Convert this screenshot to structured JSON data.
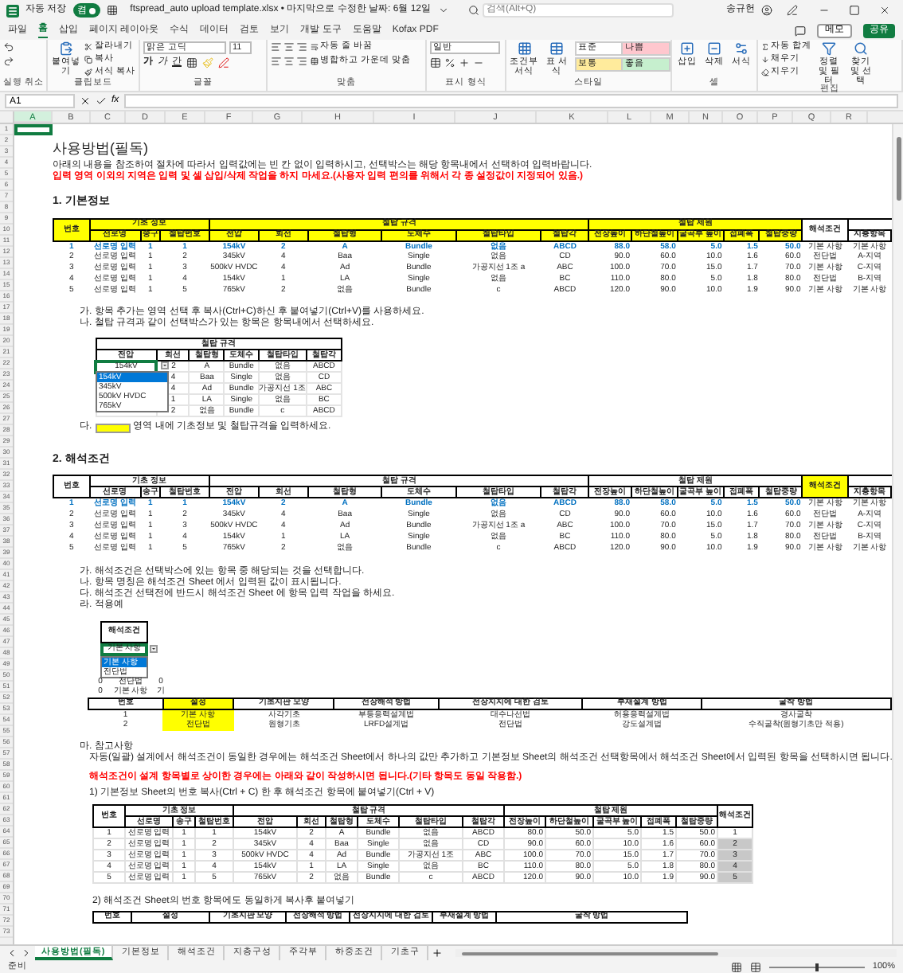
{
  "title_bar": {
    "autosave": "자동 저장",
    "autosave_on": true,
    "toggle_label": "켬",
    "filename": "ftspread_auto upload template.xlsx • 마지막으로 수정한 날짜: 6월 12일",
    "search_placeholder": "검색(Alt+Q)",
    "user": "송규헌"
  },
  "menu": [
    {
      "label": "파일",
      "selected": false
    },
    {
      "label": "홈",
      "selected": true
    },
    {
      "label": "삽입",
      "selected": false
    },
    {
      "label": "페이지 레이아웃",
      "selected": false
    },
    {
      "label": "수식",
      "selected": false
    },
    {
      "label": "데이터",
      "selected": false
    },
    {
      "label": "검토",
      "selected": false
    },
    {
      "label": "보기",
      "selected": false
    },
    {
      "label": "개발 도구",
      "selected": false
    },
    {
      "label": "도움말",
      "selected": false
    },
    {
      "label": "Kofax PDF",
      "selected": false
    }
  ],
  "menu_right": {
    "comment": "메모",
    "share": "공유"
  },
  "ribbon": {
    "undo": {
      "label": "실행 취소"
    },
    "clipboard": {
      "label": "클립보드",
      "paste": "붙여넣기",
      "cut": "잘라내기",
      "copy": "복사",
      "format_painter": "서식 복사"
    },
    "font": {
      "label": "글꼴",
      "font": "맑은 고딕",
      "size": "11",
      "bold": "가",
      "italic": "가",
      "underline": "간"
    },
    "align": {
      "label": "맞춤",
      "wrap": "자동 줄 바꿈",
      "merge": "병합하고 가운데 맞춤"
    },
    "number": {
      "label": "표시 형식",
      "format": "일반"
    },
    "styles": {
      "label": "스타일",
      "conditional": "조건부 서식",
      "table": "표 서식",
      "cells": [
        {
          "label": "표준",
          "color": "#ffffff"
        },
        {
          "label": "나쁨",
          "color": "#ffc7ce"
        },
        {
          "label": "보통",
          "color": "#ffeb9c"
        },
        {
          "label": "좋음",
          "color": "#c6efce"
        }
      ]
    },
    "cells": {
      "label": "셀",
      "insert": "삽입",
      "delete": "삭제",
      "format": "서식"
    },
    "edit": {
      "label": "편집",
      "autosum": "자동 합계",
      "fill": "채우기",
      "clear": "지우기",
      "sort": "정렬 및 필터",
      "find": "찾기 및 선택"
    }
  },
  "formula_bar": {
    "name_box": "A1",
    "function_label": "fx"
  },
  "columns": [
    "A",
    "B",
    "C",
    "D",
    "E",
    "F",
    "G",
    "H",
    "I",
    "J",
    "K",
    "L",
    "M",
    "N",
    "O",
    "P",
    "Q",
    "R"
  ],
  "row_numbers": [
    "1",
    "2",
    "3",
    "4",
    "5",
    "6",
    "7",
    "8",
    "9",
    "10",
    "11",
    "12",
    "13",
    "14",
    "15",
    "16",
    "17",
    "18",
    "19",
    "20",
    "21",
    "22",
    "23",
    "24",
    "25",
    "26",
    "27",
    "28",
    "29",
    "30",
    "31",
    "32",
    "33",
    "34",
    "35",
    "36",
    "37",
    "38",
    "39",
    "40",
    "41",
    "42",
    "43",
    "44",
    "45",
    "46",
    "47",
    "48",
    "49",
    "50",
    "51",
    "52",
    "53",
    "54",
    "55",
    "56",
    "57",
    "58",
    "59",
    "60",
    "61",
    "62",
    "63",
    "64",
    "65",
    "66",
    "67",
    "68",
    "69",
    "70",
    "71",
    "72",
    "73"
  ],
  "sheet": {
    "title": "사용방법(필독)",
    "intro": "아래의 내용을 참조하여 절차에 따라서 입력값에는 빈 칸 없이 입력하시고, 선택박스는 해당 항목내에서 선택하여 입력바랍니다.",
    "warning": "입력 영역 이외의 지역은 입력 및 셀 삽입/삭제 작업을 하지 마세요.(사용자 입력 편의를 위해서 각 종 설정값이 지정되어 있음.)",
    "section1": {
      "heading": "1. 기본정보",
      "table": {
        "groups": [
          {
            "label": "번호",
            "highlighted": true
          },
          {
            "label": "기초 정보",
            "highlighted": true,
            "columns": [
              "선로명",
              "송구",
              "철탑번호"
            ]
          },
          {
            "label": "철탑 규격",
            "highlighted": true,
            "columns": [
              "전압",
              "회선",
              "철탑형",
              "도체수",
              "철탑타입",
              "철탑각"
            ]
          },
          {
            "label": "철탑 제원",
            "highlighted": true,
            "columns": [
              "전장높이",
              "하단철높이",
              "굴곡부 높이",
              "접폐폭",
              "철탑중량"
            ]
          },
          {
            "label": "해석조건",
            "highlighted": false
          },
          {
            "highlighted": false,
            "columns": [
              "지층항목"
            ]
          }
        ],
        "rows": [
          {
            "highlighted": true,
            "cells": [
              "1",
              "선로명 입력",
              "1",
              "1",
              "154kV",
              "2",
              "A",
              "Bundle",
              "없음",
              "ABCD",
              "88.0",
              "58.0",
              "5.0",
              "1.5",
              "50.0",
              "기본 사항",
              "기본 사항"
            ]
          },
          {
            "highlighted": false,
            "cells": [
              "2",
              "선로명 입력",
              "1",
              "2",
              "345kV",
              "4",
              "Baa",
              "Single",
              "없음",
              "CD",
              "90.0",
              "60.0",
              "10.0",
              "1.6",
              "60.0",
              "전단법",
              "A-지역"
            ]
          },
          {
            "highlighted": false,
            "cells": [
              "3",
              "선로명 입력",
              "1",
              "3",
              "500kV HVDC",
              "4",
              "Ad",
              "Bundle",
              "가공지선 1조 a",
              "ABC",
              "100.0",
              "70.0",
              "15.0",
              "1.7",
              "70.0",
              "기본 사항",
              "C-지역"
            ]
          },
          {
            "highlighted": false,
            "cells": [
              "4",
              "선로명 입력",
              "1",
              "4",
              "154kV",
              "1",
              "LA",
              "Single",
              "없음",
              "BC",
              "110.0",
              "80.0",
              "5.0",
              "1.8",
              "80.0",
              "전단법",
              "B-지역"
            ]
          },
          {
            "highlighted": false,
            "cells": [
              "5",
              "선로명 입력",
              "1",
              "5",
              "765kV",
              "2",
              "없음",
              "Bundle",
              "c",
              "ABCD",
              "120.0",
              "90.0",
              "10.0",
              "1.9",
              "90.0",
              "기본 사항",
              "기본 사항"
            ]
          }
        ]
      },
      "notes": [
        "가. 항목 추가는 영역 선택 후 복사(Ctrl+C)하신 후 붙여넣기(Ctrl+V)를 사용하세요.",
        "나. 철탑 규격과 같이 선택박스가 있는 항목은 항목내에서 선택하세요."
      ],
      "spec_example": {
        "header": "철탑 규격",
        "columns": [
          "전압",
          "회선",
          "철탑형",
          "도체수",
          "철탑타입",
          "철탑각"
        ],
        "first_row": [
          "154kV",
          "2",
          "A",
          "Bundle",
          "없음",
          "ABCD"
        ],
        "options": [
          {
            "label": "154kV",
            "selected": true
          },
          {
            "label": "345kV",
            "selected": false
          },
          {
            "label": "500kV HVDC",
            "selected": false
          },
          {
            "label": "765kV",
            "selected": false
          }
        ],
        "rows": [
          [
            "",
            "4",
            "Baa",
            "Single",
            "없음",
            "CD"
          ],
          [
            "",
            "4",
            "Ad",
            "Bundle",
            "가공지선 1조",
            "ABC"
          ],
          [
            "",
            "1",
            "LA",
            "Single",
            "없음",
            "BC"
          ],
          [
            "",
            "2",
            "없음",
            "Bundle",
            "c",
            "ABCD"
          ]
        ]
      },
      "note_c": {
        "prefix": "다.",
        "text": "영역 내에 기초정보 및 철탑규격을 입력하세요."
      }
    },
    "section2": {
      "heading": "2. 해석조건",
      "table": {
        "groups": [
          {
            "label": "번호",
            "highlighted": false
          },
          {
            "label": "기초 정보",
            "highlighted": false,
            "columns": [
              "선로명",
              "송구",
              "철탑번호"
            ]
          },
          {
            "label": "철탑 규격",
            "highlighted": false,
            "columns": [
              "전압",
              "회선",
              "철탑형",
              "도체수",
              "철탑타입",
              "철탑각"
            ]
          },
          {
            "label": "철탑 제원",
            "highlighted": false,
            "columns": [
              "전장높이",
              "하단철높이",
              "굴곡부 높이",
              "접폐폭",
              "철탑중량"
            ]
          },
          {
            "label": "해석조건",
            "highlighted": true
          },
          {
            "highlighted": false,
            "columns": [
              "지층항목"
            ]
          }
        ],
        "rows": [
          {
            "highlighted": true,
            "cells": [
              "1",
              "선로명 입력",
              "1",
              "1",
              "154kV",
              "2",
              "A",
              "Bundle",
              "없음",
              "ABCD",
              "88.0",
              "58.0",
              "5.0",
              "1.5",
              "50.0",
              "기본 사항",
              "기본 사항"
            ]
          },
          {
            "highlighted": false,
            "cells": [
              "2",
              "선로명 입력",
              "1",
              "2",
              "345kV",
              "4",
              "Baa",
              "Single",
              "없음",
              "CD",
              "90.0",
              "60.0",
              "10.0",
              "1.6",
              "60.0",
              "전단법",
              "A-지역"
            ]
          },
          {
            "highlighted": false,
            "cells": [
              "3",
              "선로명 입력",
              "1",
              "3",
              "500kV HVDC",
              "4",
              "Ad",
              "Bundle",
              "가공지선 1조 a",
              "ABC",
              "100.0",
              "70.0",
              "15.0",
              "1.7",
              "70.0",
              "기본 사항",
              "C-지역"
            ]
          },
          {
            "highlighted": false,
            "cells": [
              "4",
              "선로명 입력",
              "1",
              "4",
              "154kV",
              "1",
              "LA",
              "Single",
              "없음",
              "BC",
              "110.0",
              "80.0",
              "5.0",
              "1.8",
              "80.0",
              "전단법",
              "B-지역"
            ]
          },
          {
            "highlighted": false,
            "cells": [
              "5",
              "선로명 입력",
              "1",
              "5",
              "765kV",
              "2",
              "없음",
              "Bundle",
              "c",
              "ABCD",
              "120.0",
              "90.0",
              "10.0",
              "1.9",
              "90.0",
              "기본 사항",
              "기본 사항"
            ]
          }
        ]
      },
      "notes": [
        "가. 해석조건은 선택박스에 있는 항목 중 해당되는 것을 선택합니다.",
        "나. 항목 명칭은 해석조건 Sheet 에서 입력된 값이 표시됩니다.",
        "다. 해석조건 선택전에 반드시 해석조건 Sheet 에 항목 입력 작업을 하세요.",
        "라. 적용예"
      ],
      "condition_example": {
        "header": "해석조건",
        "value": "기본 사항",
        "options": [
          {
            "label": "기본 사항",
            "selected": true
          },
          {
            "label": "전단법",
            "selected": false
          }
        ],
        "rows": [
          [
            "0",
            "전단법",
            "0"
          ],
          [
            "0",
            "기본 사항",
            "기"
          ]
        ]
      },
      "condition_table": {
        "columns": [
          {
            "label": "번호",
            "highlighted": false
          },
          {
            "label": "설정",
            "highlighted": true
          },
          {
            "label": "기초지판 모양",
            "highlighted": false
          },
          {
            "label": "전장해석 방법",
            "highlighted": false
          },
          {
            "label": "전장지지에 대한 검토",
            "highlighted": false
          },
          {
            "label": "부재설계 방법",
            "highlighted": false
          },
          {
            "label": "굴착 방법",
            "highlighted": false
          }
        ],
        "rows": [
          [
            "1",
            "기본 사항",
            "사각기초",
            "부등응력설계법",
            "대수나선법",
            "허용응력설계법",
            "경사굴착"
          ],
          [
            "2",
            "전단법",
            "원형기초",
            "LRFD설계법",
            "전단법",
            "강도설계법",
            "수직굴착(원형기초만 적용)"
          ]
        ]
      },
      "reference": {
        "heading": "마. 참고사항",
        "text": "자동(일괄) 설계에서 해석조건이 동일한 경우에는 해석조건 Sheet에서 하나의 값만 추가하고 기본정보 Sheet의 해석조건 선택항목에서 해석조건 Sheet에서 입력된 항목을 선택하시면 됩니다.",
        "warning": "해석조건이 설계 항목별로 상이한 경우에는 아래와 같이 작성하시면 됩니다.(기타 항목도 동일 작용함.)",
        "step1": "1) 기본정보 Sheet의 번호 복사(Ctrl + C) 한 후 해석조건 항목에 붙여넣기(Ctrl + V)",
        "table": {
          "groups": [
            {
              "label": "번호",
              "highlighted": false
            },
            {
              "label": "기초 정보",
              "highlighted": false,
              "columns": [
                "선로명",
                "송구",
                "철탑번호"
              ]
            },
            {
              "label": "철탑 규격",
              "highlighted": false,
              "columns": [
                "전압",
                "회선",
                "철탑형",
                "도체수",
                "철탑타입",
                "철탑각"
              ]
            },
            {
              "label": "철탑 제원",
              "highlighted": false,
              "columns": [
                "전장높이",
                "하단철높이",
                "굴곡부 높이",
                "접폐폭",
                "철탑중량"
              ]
            },
            {
              "label": "해석조건",
              "highlighted": false
            }
          ],
          "rows": [
            {
              "shaded": false,
              "cells": [
                "1",
                "선로명 입력",
                "1",
                "1",
                "154kV",
                "2",
                "A",
                "Bundle",
                "없음",
                "ABCD",
                "80.0",
                "50.0",
                "5.0",
                "1.5",
                "50.0",
                "1"
              ]
            },
            {
              "shaded": true,
              "cells": [
                "2",
                "선로명 입력",
                "1",
                "2",
                "345kV",
                "4",
                "Baa",
                "Single",
                "없음",
                "CD",
                "90.0",
                "60.0",
                "10.0",
                "1.6",
                "60.0",
                "2"
              ]
            },
            {
              "shaded": true,
              "cells": [
                "3",
                "선로명 입력",
                "1",
                "3",
                "500kV HVDC",
                "4",
                "Ad",
                "Bundle",
                "가공지선 1조",
                "ABC",
                "100.0",
                "70.0",
                "15.0",
                "1.7",
                "70.0",
                "3"
              ]
            },
            {
              "shaded": true,
              "cells": [
                "4",
                "선로명 입력",
                "1",
                "4",
                "154kV",
                "1",
                "LA",
                "Single",
                "없음",
                "BC",
                "110.0",
                "80.0",
                "5.0",
                "1.8",
                "80.0",
                "4"
              ]
            },
            {
              "shaded": true,
              "cells": [
                "5",
                "선로명 입력",
                "1",
                "5",
                "765kV",
                "2",
                "없음",
                "Bundle",
                "c",
                "ABCD",
                "120.0",
                "90.0",
                "10.0",
                "1.9",
                "90.0",
                "5"
              ]
            }
          ]
        },
        "step2": "2) 해석조건 Sheet의 번호 항목에도 동일하게 복사후 붙여넣기",
        "table2_columns": [
          "번호",
          "설정",
          "기초지판 모양",
          "전장해석 방법",
          "전장지지에 대한 검토",
          "부재설계 방법",
          "굴착 방법"
        ]
      }
    }
  },
  "sheet_tabs": [
    {
      "label": "사용방법(필독)",
      "selected": true
    },
    {
      "label": "기본정보",
      "selected": false
    },
    {
      "label": "해석조건",
      "selected": false
    },
    {
      "label": "지층구성",
      "selected": false
    },
    {
      "label": "주각부",
      "selected": false
    },
    {
      "label": "하중조건",
      "selected": false
    },
    {
      "label": "기초구",
      "selected": false
    }
  ],
  "status_bar": {
    "status": "준비",
    "zoom": "100%",
    "level": 0.5
  }
}
